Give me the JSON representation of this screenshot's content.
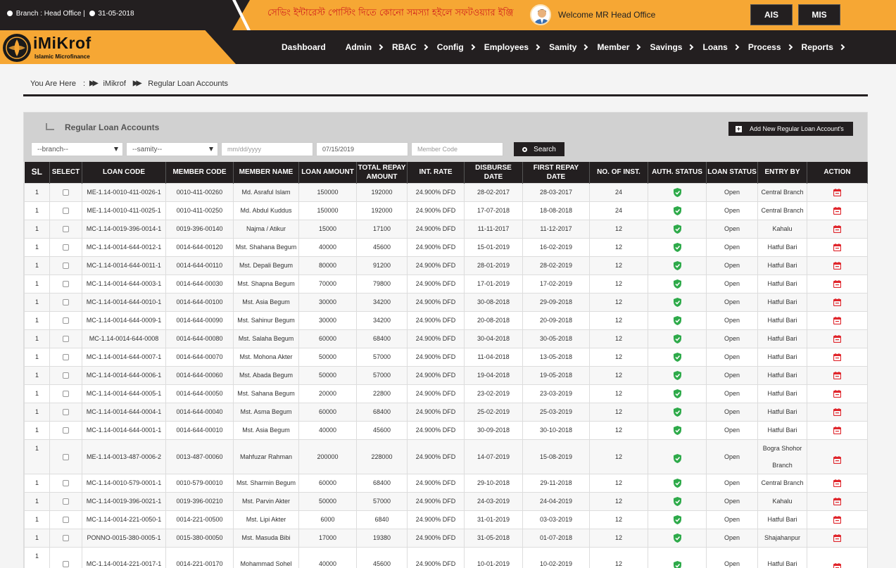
{
  "topbar": {
    "branch_label": "Branch : Head Office |",
    "date": "31-05-2018",
    "marquee": "সেভিং ইন্টারেস্ট পোস্টিং দিতে কোনো সমস্যা হইলে সফটওয়্যার ইঞ্জিনিয়ার ম",
    "welcome": "Welcome MR Head Office",
    "ais_label": "AIS",
    "mis_label": "MIS"
  },
  "logo": {
    "title": "iMiKrof",
    "subtitle": "Islamic Microfinance"
  },
  "nav": {
    "items": [
      {
        "label": "Dashboard",
        "submenu": false
      },
      {
        "label": "Admin",
        "submenu": true
      },
      {
        "label": "RBAC",
        "submenu": true
      },
      {
        "label": "Config",
        "submenu": true
      },
      {
        "label": "Employees",
        "submenu": true
      },
      {
        "label": "Samity",
        "submenu": true
      },
      {
        "label": "Member",
        "submenu": true
      },
      {
        "label": "Savings",
        "submenu": true
      },
      {
        "label": "Loans",
        "submenu": true
      },
      {
        "label": "Process",
        "submenu": true
      },
      {
        "label": "Reports",
        "submenu": true
      }
    ]
  },
  "breadcrumb": {
    "prefix": "You Are Here",
    "colon": ":",
    "items": [
      "iMikrof",
      "Regular Loan Accounts"
    ]
  },
  "panel": {
    "title": "Regular Loan Accounts",
    "add_button": "Add New Regular Loan Account's",
    "filters": {
      "branch": "--branch--",
      "samity": "--samity--",
      "date_from_placeholder": "mm/dd/yyyy",
      "date_to": "07/15/2019",
      "member_code_placeholder": "Member Code"
    },
    "search_label": "Search"
  },
  "colors": {
    "accent": "#f6a734",
    "dark": "#231f20",
    "auth_ok": "#2eaa4a",
    "action": "#e0262c"
  },
  "table": {
    "headers": [
      "SL",
      "SELECT",
      "LOAN CODE",
      "MEMBER CODE",
      "MEMBER NAME",
      "LOAN AMOUNT",
      "TOTAL REPAY AMOUNT",
      "INT. RATE",
      "DISBURSE DATE",
      "FIRST REPAY DATE",
      "NO. OF INST.",
      "AUTH. STATUS",
      "LOAN STATUS",
      "ENTRY BY",
      "ACTION"
    ],
    "rows": [
      {
        "sl": "1",
        "loan_code": "ME-1.14-0010-411-0026-1",
        "member_code": "0010-411-00260",
        "member_name": "Md. Asraful Islam",
        "loan_amount": "150000",
        "total_repay": "192000",
        "int_rate": "24.900% DFD",
        "disburse_date": "28-02-2017",
        "first_repay": "28-03-2017",
        "inst": "24",
        "loan_status": "Open",
        "entry_by": "Central Branch"
      },
      {
        "sl": "1",
        "loan_code": "ME-1.14-0010-411-0025-1",
        "member_code": "0010-411-00250",
        "member_name": "Md. Abdul Kuddus",
        "loan_amount": "150000",
        "total_repay": "192000",
        "int_rate": "24.900% DFD",
        "disburse_date": "17-07-2018",
        "first_repay": "18-08-2018",
        "inst": "24",
        "loan_status": "Open",
        "entry_by": "Central Branch"
      },
      {
        "sl": "1",
        "loan_code": "MC-1.14-0019-396-0014-1",
        "member_code": "0019-396-00140",
        "member_name": "Najma / Atikur",
        "loan_amount": "15000",
        "total_repay": "17100",
        "int_rate": "24.900% DFD",
        "disburse_date": "11-11-2017",
        "first_repay": "11-12-2017",
        "inst": "12",
        "loan_status": "Open",
        "entry_by": "Kahalu"
      },
      {
        "sl": "1",
        "loan_code": "MC-1.14-0014-644-0012-1",
        "member_code": "0014-644-00120",
        "member_name": "Mst. Shahana Begum",
        "loan_amount": "40000",
        "total_repay": "45600",
        "int_rate": "24.900% DFD",
        "disburse_date": "15-01-2019",
        "first_repay": "16-02-2019",
        "inst": "12",
        "loan_status": "Open",
        "entry_by": "Hatful Bari"
      },
      {
        "sl": "1",
        "loan_code": "MC-1.14-0014-644-0011-1",
        "member_code": "0014-644-00110",
        "member_name": "Mst. Depali Begum",
        "loan_amount": "80000",
        "total_repay": "91200",
        "int_rate": "24.900% DFD",
        "disburse_date": "28-01-2019",
        "first_repay": "28-02-2019",
        "inst": "12",
        "loan_status": "Open",
        "entry_by": "Hatful Bari"
      },
      {
        "sl": "1",
        "loan_code": "MC-1.14-0014-644-0003-1",
        "member_code": "0014-644-00030",
        "member_name": "Mst. Shapna Begum",
        "loan_amount": "70000",
        "total_repay": "79800",
        "int_rate": "24.900% DFD",
        "disburse_date": "17-01-2019",
        "first_repay": "17-02-2019",
        "inst": "12",
        "loan_status": "Open",
        "entry_by": "Hatful Bari"
      },
      {
        "sl": "1",
        "loan_code": "MC-1.14-0014-644-0010-1",
        "member_code": "0014-644-00100",
        "member_name": "Mst. Asia Begum",
        "loan_amount": "30000",
        "total_repay": "34200",
        "int_rate": "24.900% DFD",
        "disburse_date": "30-08-2018",
        "first_repay": "29-09-2018",
        "inst": "12",
        "loan_status": "Open",
        "entry_by": "Hatful Bari"
      },
      {
        "sl": "1",
        "loan_code": "MC-1.14-0014-644-0009-1",
        "member_code": "0014-644-00090",
        "member_name": "Mst. Sahinur Begum",
        "loan_amount": "30000",
        "total_repay": "34200",
        "int_rate": "24.900% DFD",
        "disburse_date": "20-08-2018",
        "first_repay": "20-09-2018",
        "inst": "12",
        "loan_status": "Open",
        "entry_by": "Hatful Bari"
      },
      {
        "sl": "1",
        "loan_code": "MC-1.14-0014-644-0008",
        "member_code": "0014-644-00080",
        "member_name": "Mst. Salaha Begum",
        "loan_amount": "60000",
        "total_repay": "68400",
        "int_rate": "24.900% DFD",
        "disburse_date": "30-04-2018",
        "first_repay": "30-05-2018",
        "inst": "12",
        "loan_status": "Open",
        "entry_by": "Hatful Bari"
      },
      {
        "sl": "1",
        "loan_code": "MC-1.14-0014-644-0007-1",
        "member_code": "0014-644-00070",
        "member_name": "Mst. Mohona Akter",
        "loan_amount": "50000",
        "total_repay": "57000",
        "int_rate": "24.900% DFD",
        "disburse_date": "11-04-2018",
        "first_repay": "13-05-2018",
        "inst": "12",
        "loan_status": "Open",
        "entry_by": "Hatful Bari"
      },
      {
        "sl": "1",
        "loan_code": "MC-1.14-0014-644-0006-1",
        "member_code": "0014-644-00060",
        "member_name": "Mst. Abada Begum",
        "loan_amount": "50000",
        "total_repay": "57000",
        "int_rate": "24.900% DFD",
        "disburse_date": "19-04-2018",
        "first_repay": "19-05-2018",
        "inst": "12",
        "loan_status": "Open",
        "entry_by": "Hatful Bari"
      },
      {
        "sl": "1",
        "loan_code": "MC-1.14-0014-644-0005-1",
        "member_code": "0014-644-00050",
        "member_name": "Mst. Sahana Begum",
        "loan_amount": "20000",
        "total_repay": "22800",
        "int_rate": "24.900% DFD",
        "disburse_date": "23-02-2019",
        "first_repay": "23-03-2019",
        "inst": "12",
        "loan_status": "Open",
        "entry_by": "Hatful Bari"
      },
      {
        "sl": "1",
        "loan_code": "MC-1.14-0014-644-0004-1",
        "member_code": "0014-644-00040",
        "member_name": "Mst. Asma Begum",
        "loan_amount": "60000",
        "total_repay": "68400",
        "int_rate": "24.900% DFD",
        "disburse_date": "25-02-2019",
        "first_repay": "25-03-2019",
        "inst": "12",
        "loan_status": "Open",
        "entry_by": "Hatful Bari"
      },
      {
        "sl": "1",
        "loan_code": "MC-1.14-0014-644-0001-1",
        "member_code": "0014-644-00010",
        "member_name": "Mst. Asia Begum",
        "loan_amount": "40000",
        "total_repay": "45600",
        "int_rate": "24.900% DFD",
        "disburse_date": "30-09-2018",
        "first_repay": "30-10-2018",
        "inst": "12",
        "loan_status": "Open",
        "entry_by": "Hatful Bari"
      },
      {
        "sl": "1",
        "loan_code": "ME-1.14-0013-487-0006-2",
        "member_code": "0013-487-00060",
        "member_name": "Mahfuzar Rahman",
        "loan_amount": "200000",
        "total_repay": "228000",
        "int_rate": "24.900% DFD",
        "disburse_date": "14-07-2019",
        "first_repay": "15-08-2019",
        "inst": "12",
        "loan_status": "Open",
        "entry_by": "Bogra Shohor Branch",
        "tall": true
      },
      {
        "sl": "1",
        "loan_code": "MC-1.14-0010-579-0001-1",
        "member_code": "0010-579-00010",
        "member_name": "Mst. Sharmin Begum",
        "loan_amount": "60000",
        "total_repay": "68400",
        "int_rate": "24.900% DFD",
        "disburse_date": "29-10-2018",
        "first_repay": "29-11-2018",
        "inst": "12",
        "loan_status": "Open",
        "entry_by": "Central Branch"
      },
      {
        "sl": "1",
        "loan_code": "MC-1.14-0019-396-0021-1",
        "member_code": "0019-396-00210",
        "member_name": "Mst. Parvin Akter",
        "loan_amount": "50000",
        "total_repay": "57000",
        "int_rate": "24.900% DFD",
        "disburse_date": "24-03-2019",
        "first_repay": "24-04-2019",
        "inst": "12",
        "loan_status": "Open",
        "entry_by": "Kahalu"
      },
      {
        "sl": "1",
        "loan_code": "MC-1.14-0014-221-0050-1",
        "member_code": "0014-221-00500",
        "member_name": "Mst. Lipi Akter",
        "loan_amount": "6000",
        "total_repay": "6840",
        "int_rate": "24.900% DFD",
        "disburse_date": "31-01-2019",
        "first_repay": "03-03-2019",
        "inst": "12",
        "loan_status": "Open",
        "entry_by": "Hatful Bari"
      },
      {
        "sl": "1",
        "loan_code": "PONNO-0015-380-0005-1",
        "member_code": "0015-380-00050",
        "member_name": "Mst. Masuda Bibi",
        "loan_amount": "17000",
        "total_repay": "19380",
        "int_rate": "24.900% DFD",
        "disburse_date": "31-05-2018",
        "first_repay": "01-07-2018",
        "inst": "12",
        "loan_status": "Open",
        "entry_by": "Shajahanpur"
      },
      {
        "sl": "1",
        "loan_code": "MC-1.14-0014-221-0017-1",
        "member_code": "0014-221-00170",
        "member_name": "Mohammad Sohel",
        "loan_amount": "40000",
        "total_repay": "45600",
        "int_rate": "24.900% DFD",
        "disburse_date": "10-01-2019",
        "first_repay": "10-02-2019",
        "inst": "12",
        "loan_status": "Open",
        "entry_by": "Hatful Bari",
        "tall": true
      }
    ]
  }
}
